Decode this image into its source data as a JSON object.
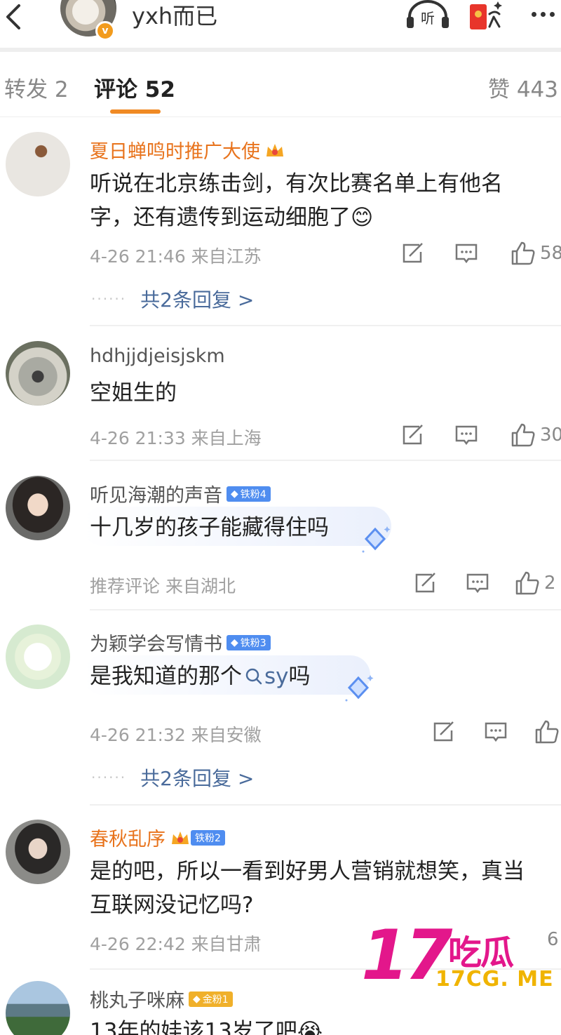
{
  "header": {
    "title": "yxh而已",
    "listen_label": "听"
  },
  "tabs": {
    "forward": "转发 2",
    "comments": "评论 52",
    "likes": "赞 443"
  },
  "comments": [
    {
      "name": "夏日蝉鸣时推广大使",
      "text": "听说在北京练击剑，有次比赛名单上有他名字，还有遗传到运动细胞了",
      "emoji": "😊",
      "meta": "4-26 21:46 来自江苏",
      "likes": "58",
      "replies": "共2条回复 >"
    },
    {
      "name": "hdhjjdjeisjskm",
      "text": "空姐生的",
      "meta": "4-26 21:33 来自上海",
      "likes": "30"
    },
    {
      "name": "听见海潮的声音",
      "badge": "铁粉4",
      "text": "十几岁的孩子能藏得住吗",
      "meta": "推荐评论  来自湖北",
      "likes": "2"
    },
    {
      "name": "为颖学会写情书",
      "badge": "铁粉3",
      "text_before": "是我知道的那个",
      "search_term": "sy",
      "text_after": "吗",
      "meta": "4-26 21:32 来自安徽",
      "likes": "",
      "replies": "共2条回复 >"
    },
    {
      "name": "春秋乱序",
      "badge": "铁粉2",
      "text": "是的吧，所以一看到好男人营销就想笑，真当互联网没记忆吗?",
      "meta": "4-26 22:42 来自甘肃",
      "likes": "6"
    },
    {
      "name": "桃丸子咪麻",
      "badge": "金粉1",
      "text": "13年的娃该13岁了吧",
      "emoji": "😭"
    }
  ],
  "reply_dots": "······",
  "watermark": {
    "number": "17",
    "chinese": "吃瓜",
    "url": "17CG. ME"
  },
  "colors": {
    "accent": "#f08a24",
    "username_highlight": "#e8731c",
    "link": "#4a6b9b",
    "fan_badge": "#4f8df0",
    "gold_badge": "#f0b02a",
    "watermark_pink": "#e3178b",
    "watermark_yellow": "#f0b400"
  }
}
